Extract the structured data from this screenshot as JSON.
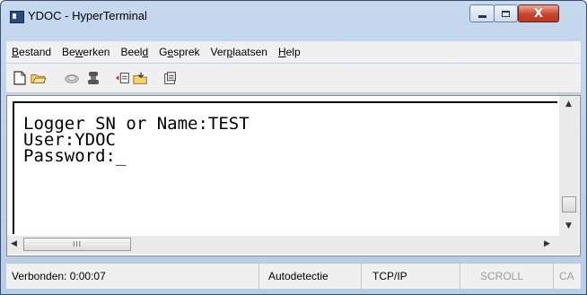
{
  "window": {
    "title": "YDOC - HyperTerminal",
    "close_glyph": "X"
  },
  "menu": {
    "items": [
      {
        "before": "",
        "key": "B",
        "after": "estand"
      },
      {
        "before": "Be",
        "key": "w",
        "after": "erken"
      },
      {
        "before": "Beel",
        "key": "d",
        "after": ""
      },
      {
        "before": "G",
        "key": "e",
        "after": "sprek"
      },
      {
        "before": "Ver",
        "key": "p",
        "after": "laatsen"
      },
      {
        "before": "",
        "key": "H",
        "after": "elp"
      }
    ]
  },
  "toolbar": {
    "icons": [
      "new-file-icon",
      "open-folder-icon",
      "disconnect-icon",
      "dial-icon",
      "send-icon",
      "receive-icon",
      "properties-icon"
    ]
  },
  "terminal": {
    "lines": [
      "Logger SN or Name:TEST",
      "User:YDOC",
      "Password:_"
    ]
  },
  "scrollbar": {
    "h_grip": "III"
  },
  "status": {
    "connected": "Verbonden: 0:00:07",
    "detect": "Autodetectie",
    "protocol": "TCP/IP",
    "scroll": "SCROLL",
    "caps": "CA"
  }
}
